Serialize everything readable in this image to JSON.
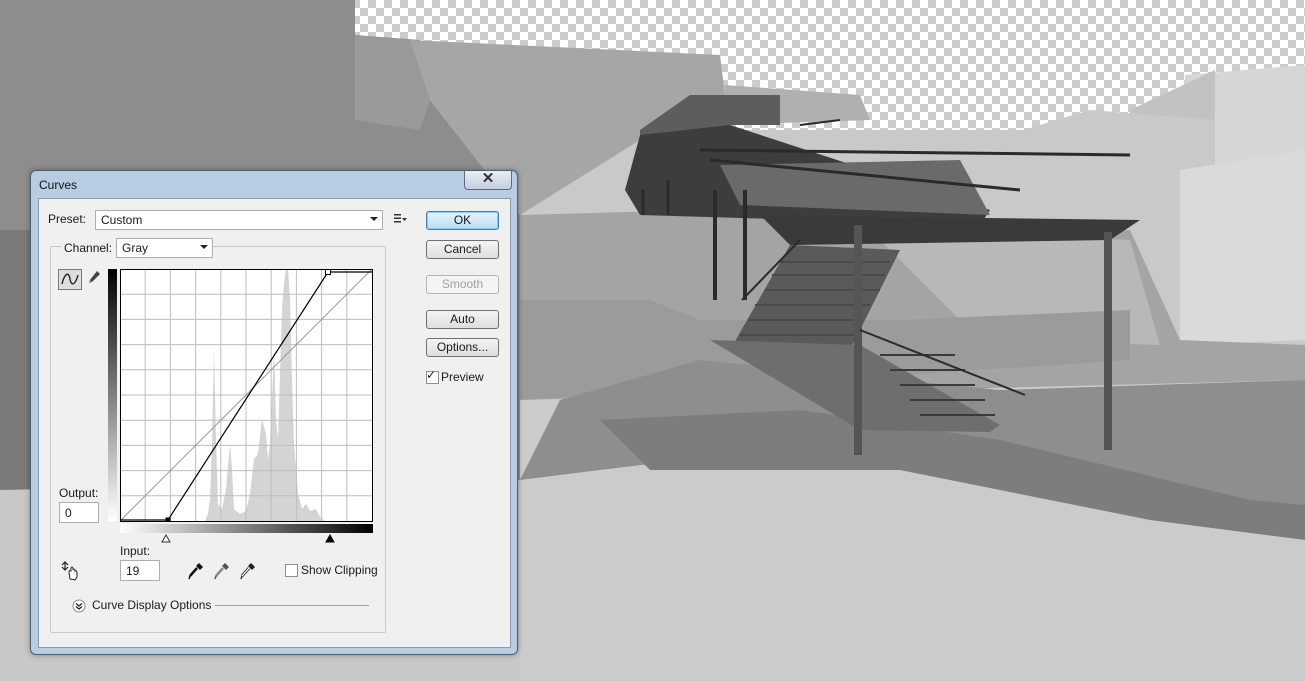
{
  "dialog": {
    "title": "Curves",
    "close_label": "✕",
    "preset_label": "Preset:",
    "preset_value": "Custom",
    "channel_label": "Channel:",
    "channel_value": "Gray",
    "buttons": {
      "ok": "OK",
      "cancel": "Cancel",
      "smooth": "Smooth",
      "auto": "Auto",
      "options": "Options..."
    },
    "preview_label": "Preview",
    "preview_checked": true,
    "output_label": "Output:",
    "output_value": "0",
    "input_label": "Input:",
    "input_value": "19",
    "show_clipping_label": "Show Clipping",
    "show_clipping_checked": false,
    "curve_display_options_label": "Curve Display Options"
  },
  "icons": {
    "preset_menu": "preset-options-icon",
    "curve_tool": "curve-point-tool-icon",
    "pencil_tool": "pencil-tool-icon",
    "target_adjust": "target-adjustment-hand-icon",
    "black_eyedropper": "black-point-eyedropper-icon",
    "gray_eyedropper": "gray-point-eyedropper-icon",
    "white_eyedropper": "white-point-eyedropper-icon",
    "expand": "expand-chevron-icon"
  },
  "colors": {
    "ok_border": "#3c7fb1",
    "frame": "#b9cde2"
  }
}
